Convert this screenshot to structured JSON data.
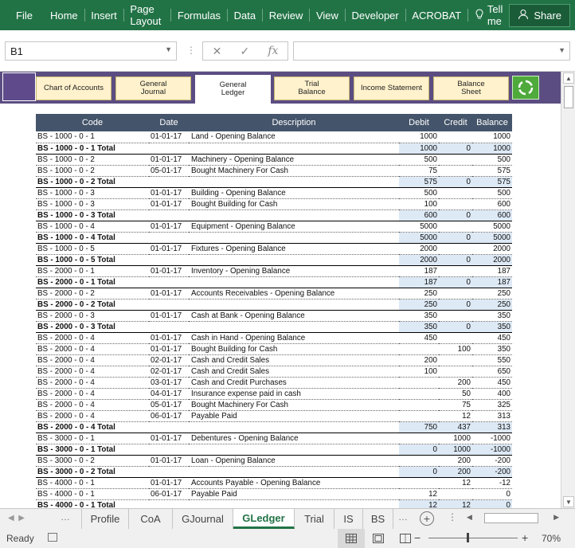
{
  "ribbon": {
    "file": "File",
    "tabs": [
      "Home",
      "Insert",
      "Page Layout",
      "Formulas",
      "Data",
      "Review",
      "View",
      "Developer",
      "ACROBAT"
    ],
    "tell_me": "Tell me",
    "share": "Share"
  },
  "formula_bar": {
    "name_box": "B1",
    "fx": "fx",
    "value": ""
  },
  "nav": {
    "buttons": [
      "Chart of Accounts",
      "General Journal",
      "General Ledger",
      "Trial Balance",
      "Income Statement",
      "Balance Sheet"
    ],
    "active": "General Ledger"
  },
  "table": {
    "headers": [
      "Code",
      "Date",
      "Description",
      "Debit",
      "Credit",
      "Balance"
    ],
    "rows": [
      {
        "t": "d",
        "code": "BS - 1000 - 0 - 1",
        "date": "01-01-17",
        "desc": "Land - Opening Balance",
        "debit": "1000",
        "credit": "",
        "balance": "1000"
      },
      {
        "t": "t",
        "code": "BS - 1000 - 0 - 1 Total",
        "date": "",
        "desc": "",
        "debit": "1000",
        "credit": "0",
        "balance": "1000"
      },
      {
        "t": "d",
        "code": "BS - 1000 - 0 - 2",
        "date": "01-01-17",
        "desc": "Machinery - Opening Balance",
        "debit": "500",
        "credit": "",
        "balance": "500"
      },
      {
        "t": "d",
        "code": "BS - 1000 - 0 - 2",
        "date": "05-01-17",
        "desc": "Bought Machinery For Cash",
        "debit": "75",
        "credit": "",
        "balance": "575"
      },
      {
        "t": "t",
        "code": "BS - 1000 - 0 - 2 Total",
        "date": "",
        "desc": "",
        "debit": "575",
        "credit": "0",
        "balance": "575"
      },
      {
        "t": "d",
        "code": "BS - 1000 - 0 - 3",
        "date": "01-01-17",
        "desc": "Building - Opening Balance",
        "debit": "500",
        "credit": "",
        "balance": "500"
      },
      {
        "t": "d",
        "code": "BS - 1000 - 0 - 3",
        "date": "01-01-17",
        "desc": "Bought Building for Cash",
        "debit": "100",
        "credit": "",
        "balance": "600"
      },
      {
        "t": "t",
        "code": "BS - 1000 - 0 - 3 Total",
        "date": "",
        "desc": "",
        "debit": "600",
        "credit": "0",
        "balance": "600"
      },
      {
        "t": "d",
        "code": "BS - 1000 - 0 - 4",
        "date": "01-01-17",
        "desc": "Equipment - Opening Balance",
        "debit": "5000",
        "credit": "",
        "balance": "5000"
      },
      {
        "t": "t",
        "code": "BS - 1000 - 0 - 4 Total",
        "date": "",
        "desc": "",
        "debit": "5000",
        "credit": "0",
        "balance": "5000"
      },
      {
        "t": "d",
        "code": "BS - 1000 - 0 - 5",
        "date": "01-01-17",
        "desc": "Fixtures - Opening Balance",
        "debit": "2000",
        "credit": "",
        "balance": "2000"
      },
      {
        "t": "t",
        "code": "BS - 1000 - 0 - 5 Total",
        "date": "",
        "desc": "",
        "debit": "2000",
        "credit": "0",
        "balance": "2000"
      },
      {
        "t": "d",
        "code": "BS - 2000 - 0 - 1",
        "date": "01-01-17",
        "desc": "Inventory - Opening Balance",
        "debit": "187",
        "credit": "",
        "balance": "187"
      },
      {
        "t": "t",
        "code": "BS - 2000 - 0 - 1 Total",
        "date": "",
        "desc": "",
        "debit": "187",
        "credit": "0",
        "balance": "187"
      },
      {
        "t": "d",
        "code": "BS - 2000 - 0 - 2",
        "date": "01-01-17",
        "desc": "Accounts Receivables - Opening Balance",
        "debit": "250",
        "credit": "",
        "balance": "250"
      },
      {
        "t": "t",
        "code": "BS - 2000 - 0 - 2 Total",
        "date": "",
        "desc": "",
        "debit": "250",
        "credit": "0",
        "balance": "250"
      },
      {
        "t": "d",
        "code": "BS - 2000 - 0 - 3",
        "date": "01-01-17",
        "desc": "Cash at Bank - Opening Balance",
        "debit": "350",
        "credit": "",
        "balance": "350"
      },
      {
        "t": "t",
        "code": "BS - 2000 - 0 - 3 Total",
        "date": "",
        "desc": "",
        "debit": "350",
        "credit": "0",
        "balance": "350"
      },
      {
        "t": "d",
        "code": "BS - 2000 - 0 - 4",
        "date": "01-01-17",
        "desc": "Cash in Hand - Opening Balance",
        "debit": "450",
        "credit": "",
        "balance": "450"
      },
      {
        "t": "d",
        "code": "BS - 2000 - 0 - 4",
        "date": "01-01-17",
        "desc": "Bought Building for Cash",
        "debit": "",
        "credit": "100",
        "balance": "350"
      },
      {
        "t": "d",
        "code": "BS - 2000 - 0 - 4",
        "date": "02-01-17",
        "desc": "Cash and Credit Sales",
        "debit": "200",
        "credit": "",
        "balance": "550"
      },
      {
        "t": "d",
        "code": "BS - 2000 - 0 - 4",
        "date": "02-01-17",
        "desc": "Cash and Credit Sales",
        "debit": "100",
        "credit": "",
        "balance": "650"
      },
      {
        "t": "d",
        "code": "BS - 2000 - 0 - 4",
        "date": "03-01-17",
        "desc": "Cash and Credit Purchases",
        "debit": "",
        "credit": "200",
        "balance": "450"
      },
      {
        "t": "d",
        "code": "BS - 2000 - 0 - 4",
        "date": "04-01-17",
        "desc": "Insurance expense paid in cash",
        "debit": "",
        "credit": "50",
        "balance": "400"
      },
      {
        "t": "d",
        "code": "BS - 2000 - 0 - 4",
        "date": "05-01-17",
        "desc": "Bought Machinery For Cash",
        "debit": "",
        "credit": "75",
        "balance": "325"
      },
      {
        "t": "d",
        "code": "BS - 2000 - 0 - 4",
        "date": "06-01-17",
        "desc": "Payable Paid",
        "debit": "",
        "credit": "12",
        "balance": "313"
      },
      {
        "t": "t",
        "code": "BS - 2000 - 0 - 4 Total",
        "date": "",
        "desc": "",
        "debit": "750",
        "credit": "437",
        "balance": "313"
      },
      {
        "t": "d",
        "code": "BS - 3000 - 0 - 1",
        "date": "01-01-17",
        "desc": "Debentures - Opening Balance",
        "debit": "",
        "credit": "1000",
        "balance": "-1000"
      },
      {
        "t": "t",
        "code": "BS - 3000 - 0 - 1 Total",
        "date": "",
        "desc": "",
        "debit": "0",
        "credit": "1000",
        "balance": "-1000"
      },
      {
        "t": "d",
        "code": "BS - 3000 - 0 - 2",
        "date": "01-01-17",
        "desc": "Loan - Opening Balance",
        "debit": "",
        "credit": "200",
        "balance": "-200"
      },
      {
        "t": "t",
        "code": "BS - 3000 - 0 - 2 Total",
        "date": "",
        "desc": "",
        "debit": "0",
        "credit": "200",
        "balance": "-200"
      },
      {
        "t": "d",
        "code": "BS - 4000 - 0 - 1",
        "date": "01-01-17",
        "desc": "Accounts Payable - Opening Balance",
        "debit": "",
        "credit": "12",
        "balance": "-12"
      },
      {
        "t": "d",
        "code": "BS - 4000 - 0 - 1",
        "date": "06-01-17",
        "desc": "Payable Paid",
        "debit": "12",
        "credit": "",
        "balance": "0"
      },
      {
        "t": "t",
        "code": "BS - 4000 - 0 - 1 Total",
        "date": "",
        "desc": "",
        "debit": "12",
        "credit": "12",
        "balance": "0"
      }
    ]
  },
  "sheet_tabs": {
    "tabs": [
      "Profile",
      "CoA",
      "GJournal",
      "GLedger",
      "Trial",
      "IS",
      "BS"
    ],
    "active": "GLedger"
  },
  "status": {
    "ready": "Ready",
    "zoom": "70%"
  }
}
